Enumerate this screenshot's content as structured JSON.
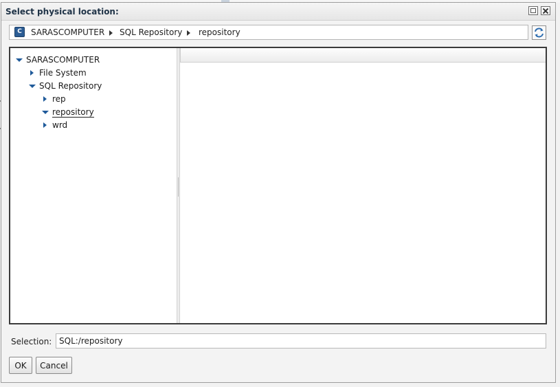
{
  "dialog": {
    "title": "Select physical location:"
  },
  "window_controls": {
    "restore_icon": "restore-icon",
    "close_icon": "close-icon"
  },
  "breadcrumb": {
    "icon": "computer-icon",
    "items": [
      "SARASCOMPUTER",
      "SQL Repository",
      "repository"
    ],
    "refresh_icon": "refresh-icon"
  },
  "tree": {
    "nodes": [
      {
        "label": "SARASCOMPUTER",
        "depth": 0,
        "state": "expanded"
      },
      {
        "label": "File System",
        "depth": 1,
        "state": "collapsed"
      },
      {
        "label": "SQL Repository",
        "depth": 1,
        "state": "expanded"
      },
      {
        "label": "rep",
        "depth": 2,
        "state": "collapsed"
      },
      {
        "label": "repository",
        "depth": 2,
        "state": "expanded",
        "selected": true
      },
      {
        "label": "wrd",
        "depth": 2,
        "state": "collapsed"
      }
    ]
  },
  "selection": {
    "label": "Selection:",
    "value": "SQL:/repository"
  },
  "buttons": {
    "ok": "OK",
    "cancel": "Cancel"
  },
  "colors": {
    "tree_arrow": "#1f5a9a",
    "title_text": "#1f3347",
    "computer_icon_bg": "#2c5d95"
  }
}
